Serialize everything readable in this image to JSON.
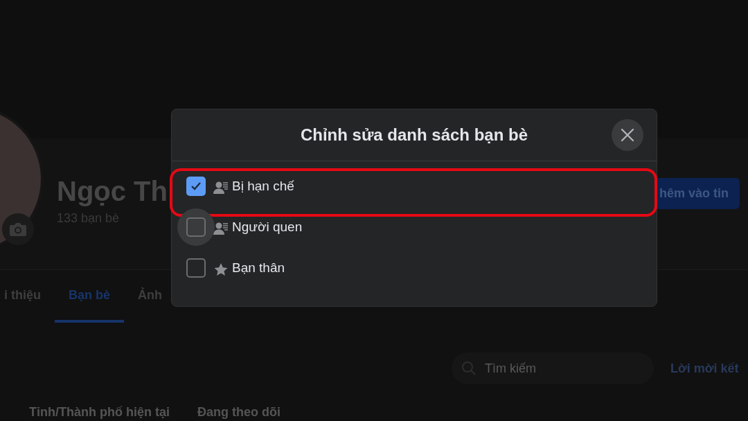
{
  "profile": {
    "name": "Ngọc Th",
    "friend_count": "133 bạn bè",
    "story_button": "hêm vào tin"
  },
  "tabs": [
    {
      "label": "i thiệu",
      "selected": false
    },
    {
      "label": "Bạn bè",
      "selected": true
    },
    {
      "label": "Ảnh",
      "selected": false
    }
  ],
  "search": {
    "placeholder": "Tìm kiếm"
  },
  "friend_requests_link": "Lời mời kết",
  "filters": [
    "Tỉnh/Thành phố hiện tại",
    "Đang theo dõi"
  ],
  "dialog": {
    "title": "Chỉnh sửa danh sách bạn bè",
    "lists": [
      {
        "label": "Bị hạn chế",
        "kind": "list",
        "checked": true,
        "hovered": false,
        "highlighted": true
      },
      {
        "label": "Người quen",
        "kind": "list",
        "checked": false,
        "hovered": true,
        "highlighted": false
      },
      {
        "label": "Bạn thân",
        "kind": "star",
        "checked": false,
        "hovered": false,
        "highlighted": false
      }
    ]
  }
}
